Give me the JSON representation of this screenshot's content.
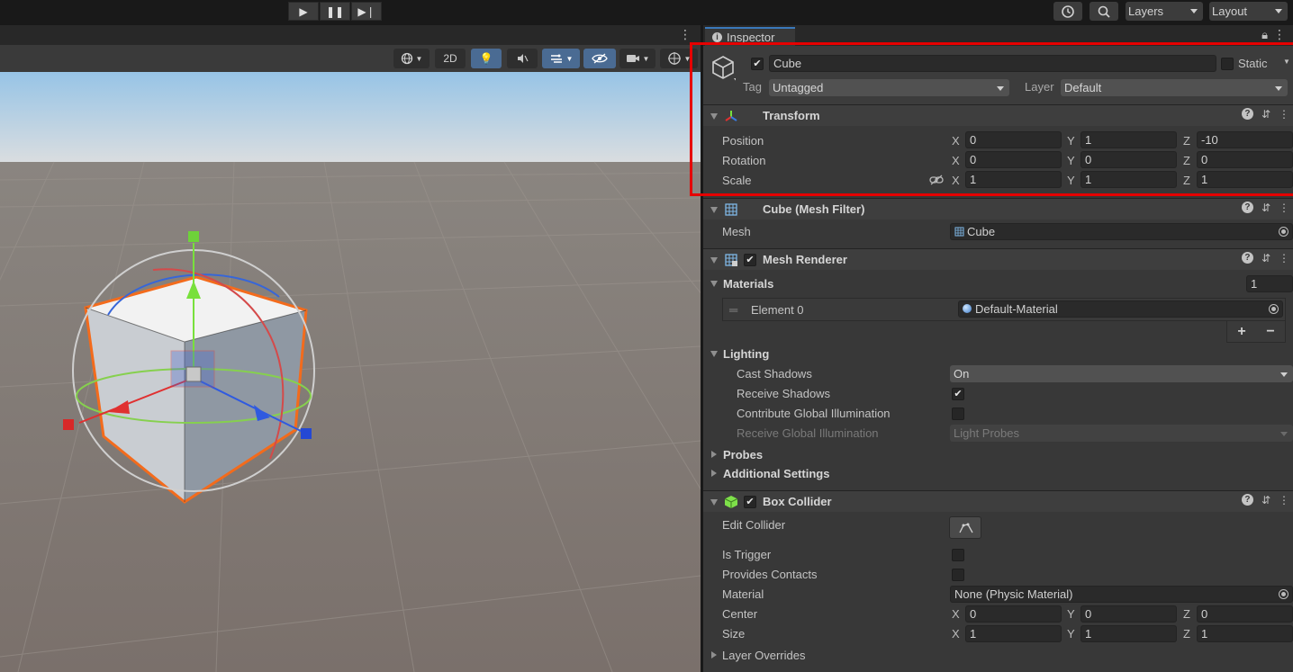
{
  "toolbar": {
    "play_icon": "play-icon",
    "pause_icon": "pause-icon",
    "step_icon": "step-icon",
    "history_icon": "history-icon",
    "search_icon": "search-icon",
    "layers_label": "Layers",
    "layout_label": "Layout"
  },
  "scene": {
    "toolbar": {
      "two_d_label": "2D"
    }
  },
  "inspector": {
    "tab_label": "Inspector",
    "object": {
      "name": "Cube",
      "active": true,
      "static_label": "Static",
      "tag_label": "Tag",
      "tag_value": "Untagged",
      "layer_label": "Layer",
      "layer_value": "Default"
    },
    "transform": {
      "title": "Transform",
      "rows": [
        {
          "label": "Position",
          "x": "0",
          "y": "1",
          "z": "-10"
        },
        {
          "label": "Rotation",
          "x": "0",
          "y": "0",
          "z": "0"
        },
        {
          "label": "Scale",
          "x": "1",
          "y": "1",
          "z": "1"
        }
      ],
      "axis_x": "X",
      "axis_y": "Y",
      "axis_z": "Z"
    },
    "mesh_filter": {
      "title": "Cube (Mesh Filter)",
      "mesh_label": "Mesh",
      "mesh_value": "Cube"
    },
    "mesh_renderer": {
      "title": "Mesh Renderer",
      "enabled": true,
      "materials_label": "Materials",
      "materials_count": "1",
      "element_label": "Element 0",
      "element_value": "Default-Material",
      "add_label": "+",
      "remove_label": "−",
      "lighting_label": "Lighting",
      "cast_shadows_label": "Cast Shadows",
      "cast_shadows_value": "On",
      "receive_shadows_label": "Receive Shadows",
      "receive_shadows": true,
      "contribute_gi_label": "Contribute Global Illumination",
      "contribute_gi": false,
      "receive_gi_label": "Receive Global Illumination",
      "receive_gi_value": "Light Probes",
      "probes_label": "Probes",
      "additional_label": "Additional Settings"
    },
    "box_collider": {
      "title": "Box Collider",
      "enabled": true,
      "edit_collider_label": "Edit Collider",
      "is_trigger_label": "Is Trigger",
      "provides_contacts_label": "Provides Contacts",
      "material_label": "Material",
      "material_value": "None (Physic Material)",
      "center_label": "Center",
      "center": {
        "x": "0",
        "y": "0",
        "z": "0"
      },
      "size_label": "Size",
      "size": {
        "x": "1",
        "y": "1",
        "z": "1"
      },
      "layer_overrides_label": "Layer Overrides"
    }
  }
}
